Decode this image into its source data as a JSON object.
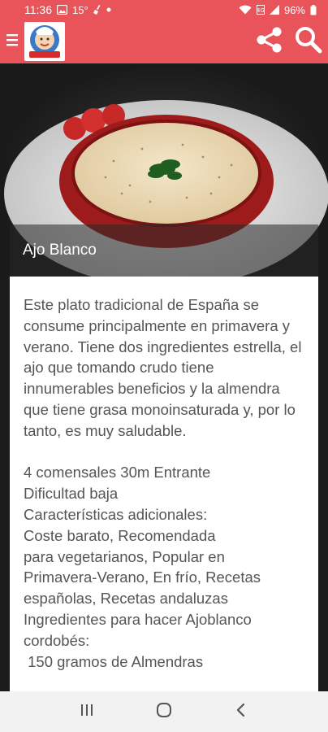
{
  "status_bar": {
    "time": "11:36",
    "temperature": "15°",
    "battery": "96%",
    "icons": [
      "image-icon",
      "shield-icon",
      "broom-icon",
      "dot-icon",
      "wifi-icon",
      "volte-icon",
      "signal-icon",
      "battery-icon"
    ]
  },
  "app_bar": {
    "icons": [
      "menu-icon",
      "app-logo",
      "share-icon",
      "search-icon"
    ],
    "color": "#e9545a"
  },
  "recipe": {
    "title": "Ajo Blanco",
    "description": "Este plato tradicional de España se consume principalmente en primavera y verano. Tiene dos ingredientes estrella, el ajo que tomando crudo tiene innumerables beneficios y la almendra que tiene grasa monoinsaturada y, por lo tanto, es muy saludable.",
    "details": "4 comensales 30m Entrante\nDificultad baja\nCaracterísticas adicionales:\nCoste barato, Recomendada\npara vegetarianos, Popular en\nPrimavera-Verano, En frío, Recetas\nespañolas, Recetas andaluzas\nIngredientes para hacer Ajoblanco\ncordobés:\n 150 gramos de Almendras"
  },
  "nav_bar": {
    "icons": [
      "recent-apps-icon",
      "home-icon",
      "back-icon"
    ]
  }
}
